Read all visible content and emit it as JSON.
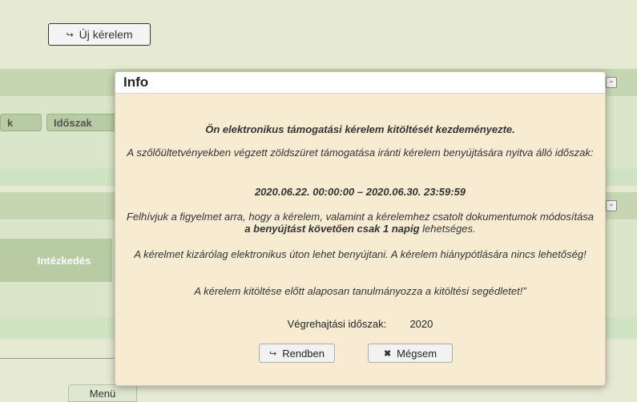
{
  "header": {
    "new_request_label": "Új kérelem",
    "new_request_icon": "reply-arrow-icon"
  },
  "background": {
    "tab_labels": [
      "k",
      "Időszak"
    ],
    "column_header": "Intézkedés",
    "menu_label": "Menü"
  },
  "modal": {
    "title": "Info",
    "line1": "Ön elektronikus támogatási kérelem kitöltését kezdeményezte.",
    "line2": "A szőlőültetvényekben végzett zöldszüret támogatása iránti kérelem benyújtására nyitva álló időszak:",
    "period": "2020.06.22. 00:00:00 – 2020.06.30. 23:59:59",
    "line3_pre": "Felhívjuk a figyelmet arra, hogy a kérelem, valamint a kérelemhez csatolt dokumentumok módosítása ",
    "line3_bold": "a benyújtást követően csak 1 napig",
    "line3_post": " lehetséges.",
    "line4": "A kérelmet kizárólag elektronikus úton lehet benyújtani. A kérelem hiánypótlására nincs lehetőség!",
    "line5": "A kérelem kitöltése előtt alaposan tanulmányozza a kitöltési segédletet!”",
    "period_label": "Végrehajtási időszak:",
    "period_value": "2020",
    "ok_label": "Rendben",
    "cancel_label": "Mégsem"
  },
  "colors": {
    "page_bg": "#e6ead3",
    "panel_header": "#c6d6b3",
    "modal_bg": "#f7ecd2"
  }
}
